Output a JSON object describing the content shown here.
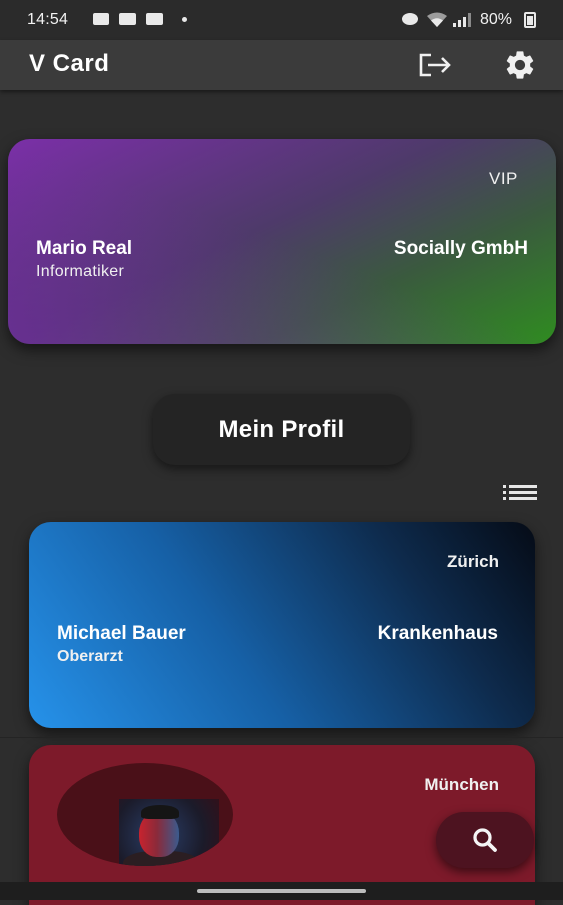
{
  "status_bar": {
    "time": "14:54",
    "battery": "80%"
  },
  "app_bar": {
    "title": "V Card",
    "logout_icon": "logout-icon",
    "settings_icon": "gear-icon"
  },
  "own_card": {
    "badge": "VIP",
    "name": "Mario Real",
    "role": "Informatiker",
    "company": "Socially GmbH",
    "colors": [
      "#7b2fa8",
      "#2f8c20"
    ]
  },
  "profile_button": {
    "label": "Mein Profil"
  },
  "list_toggle_icon": "list-icon",
  "contacts": [
    {
      "city": "Zürich",
      "name": "Michael Bauer",
      "role": "Oberarzt",
      "company": "Krankenhaus",
      "colors": [
        "#2692ea",
        "#050b16"
      ]
    },
    {
      "city": "München",
      "has_avatar": true,
      "color": "#7d1a2a"
    }
  ],
  "fab": {
    "icon": "search-icon"
  }
}
